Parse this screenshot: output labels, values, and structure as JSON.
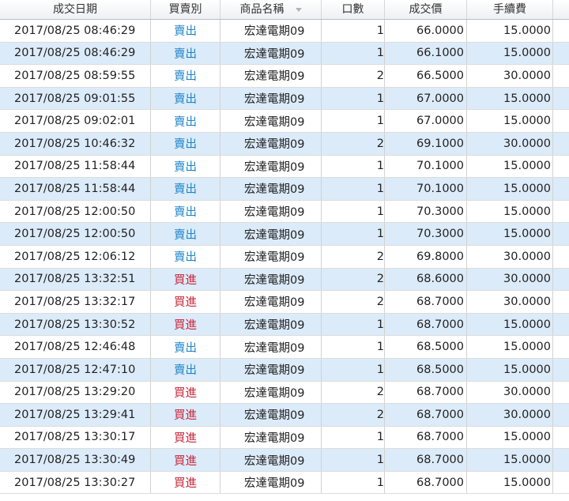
{
  "columns": [
    "成交日期",
    "買賣別",
    "商品名稱",
    "口數",
    "成交價",
    "手續費"
  ],
  "colors": {
    "sell": "#1f86c9",
    "buy": "#c8283c",
    "row_alt": "#dcebf9"
  },
  "rows": [
    {
      "date": "2017/08/25 08:46:29",
      "side": "賣出",
      "type": "sell",
      "product": "宏達電期09",
      "qty": "1",
      "price": "66.0000",
      "fee": "15.0000"
    },
    {
      "date": "2017/08/25 08:46:29",
      "side": "賣出",
      "type": "sell",
      "product": "宏達電期09",
      "qty": "1",
      "price": "66.1000",
      "fee": "15.0000"
    },
    {
      "date": "2017/08/25 08:59:55",
      "side": "賣出",
      "type": "sell",
      "product": "宏達電期09",
      "qty": "2",
      "price": "66.5000",
      "fee": "30.0000"
    },
    {
      "date": "2017/08/25 09:01:55",
      "side": "賣出",
      "type": "sell",
      "product": "宏達電期09",
      "qty": "1",
      "price": "67.0000",
      "fee": "15.0000"
    },
    {
      "date": "2017/08/25 09:02:01",
      "side": "賣出",
      "type": "sell",
      "product": "宏達電期09",
      "qty": "1",
      "price": "67.0000",
      "fee": "15.0000"
    },
    {
      "date": "2017/08/25 10:46:32",
      "side": "賣出",
      "type": "sell",
      "product": "宏達電期09",
      "qty": "2",
      "price": "69.1000",
      "fee": "30.0000"
    },
    {
      "date": "2017/08/25 11:58:44",
      "side": "賣出",
      "type": "sell",
      "product": "宏達電期09",
      "qty": "1",
      "price": "70.1000",
      "fee": "15.0000"
    },
    {
      "date": "2017/08/25 11:58:44",
      "side": "賣出",
      "type": "sell",
      "product": "宏達電期09",
      "qty": "1",
      "price": "70.1000",
      "fee": "15.0000"
    },
    {
      "date": "2017/08/25 12:00:50",
      "side": "賣出",
      "type": "sell",
      "product": "宏達電期09",
      "qty": "1",
      "price": "70.3000",
      "fee": "15.0000"
    },
    {
      "date": "2017/08/25 12:00:50",
      "side": "賣出",
      "type": "sell",
      "product": "宏達電期09",
      "qty": "1",
      "price": "70.3000",
      "fee": "15.0000"
    },
    {
      "date": "2017/08/25 12:06:12",
      "side": "賣出",
      "type": "sell",
      "product": "宏達電期09",
      "qty": "2",
      "price": "69.8000",
      "fee": "30.0000"
    },
    {
      "date": "2017/08/25 13:32:51",
      "side": "買進",
      "type": "buy",
      "product": "宏達電期09",
      "qty": "2",
      "price": "68.6000",
      "fee": "30.0000"
    },
    {
      "date": "2017/08/25 13:32:17",
      "side": "買進",
      "type": "buy",
      "product": "宏達電期09",
      "qty": "2",
      "price": "68.7000",
      "fee": "30.0000"
    },
    {
      "date": "2017/08/25 13:30:52",
      "side": "買進",
      "type": "buy",
      "product": "宏達電期09",
      "qty": "1",
      "price": "68.7000",
      "fee": "15.0000"
    },
    {
      "date": "2017/08/25 12:46:48",
      "side": "賣出",
      "type": "sell",
      "product": "宏達電期09",
      "qty": "1",
      "price": "68.5000",
      "fee": "15.0000"
    },
    {
      "date": "2017/08/25 12:47:10",
      "side": "賣出",
      "type": "sell",
      "product": "宏達電期09",
      "qty": "1",
      "price": "68.5000",
      "fee": "15.0000"
    },
    {
      "date": "2017/08/25 13:29:20",
      "side": "買進",
      "type": "buy",
      "product": "宏達電期09",
      "qty": "2",
      "price": "68.7000",
      "fee": "30.0000"
    },
    {
      "date": "2017/08/25 13:29:41",
      "side": "買進",
      "type": "buy",
      "product": "宏達電期09",
      "qty": "2",
      "price": "68.7000",
      "fee": "30.0000"
    },
    {
      "date": "2017/08/25 13:30:17",
      "side": "買進",
      "type": "buy",
      "product": "宏達電期09",
      "qty": "1",
      "price": "68.7000",
      "fee": "15.0000"
    },
    {
      "date": "2017/08/25 13:30:49",
      "side": "買進",
      "type": "buy",
      "product": "宏達電期09",
      "qty": "1",
      "price": "68.7000",
      "fee": "15.0000"
    },
    {
      "date": "2017/08/25 13:30:27",
      "side": "買進",
      "type": "buy",
      "product": "宏達電期09",
      "qty": "1",
      "price": "68.7000",
      "fee": "15.0000"
    }
  ]
}
